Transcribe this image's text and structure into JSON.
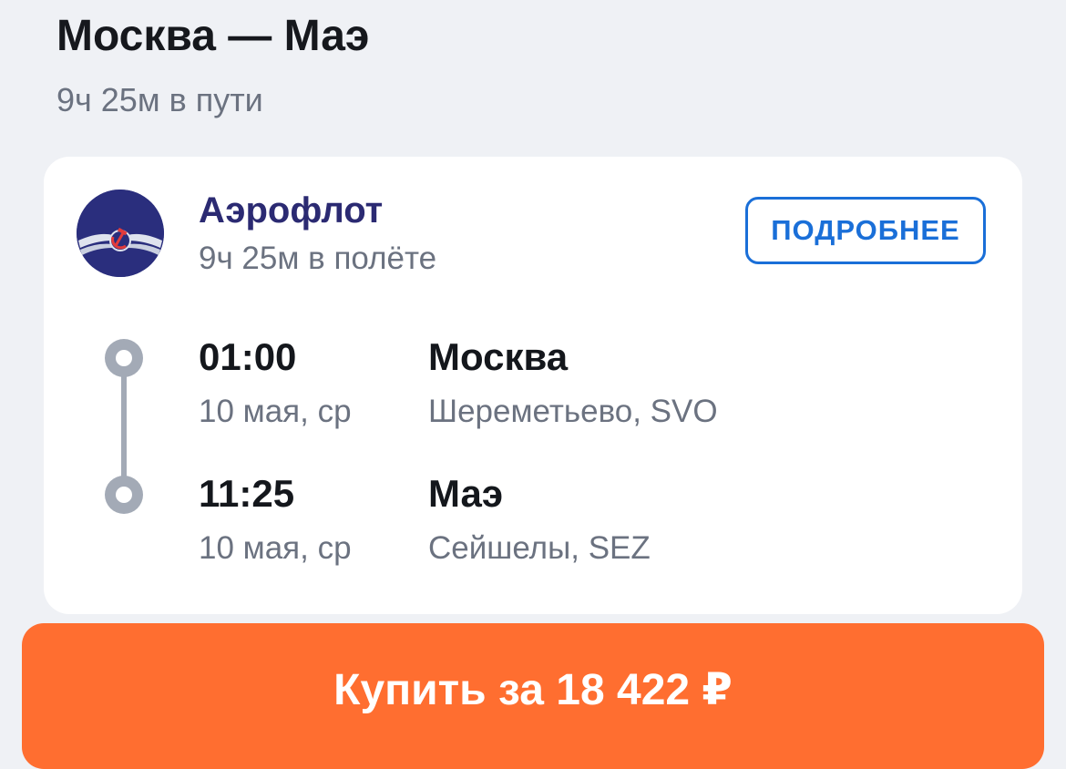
{
  "header": {
    "title": "Москва — Маэ",
    "duration": "9ч 25м в пути"
  },
  "flight": {
    "airline": "Аэрофлот",
    "airline_logo_icon": "aeroflot-winged-hammer-sickle-logo",
    "flight_duration": "9ч 25м в полёте",
    "details_label": "ПОДРОБНЕЕ",
    "departure": {
      "time": "01:00",
      "date": "10 мая, ср",
      "city": "Москва",
      "airport": "Шереметьево, SVO"
    },
    "arrival": {
      "time": "11:25",
      "date": "10 мая, ср",
      "city": "Маэ",
      "airport": "Сейшелы, SEZ"
    }
  },
  "purchase": {
    "label": "Купить за 18 422 ₽"
  },
  "colors": {
    "background": "#eff1f5",
    "card": "#ffffff",
    "airline_name": "#2b2a72",
    "accent_blue": "#1a6fd8",
    "buy_button": "#ff6e30",
    "timeline": "#a3aab6",
    "secondary_text": "#6b7280"
  }
}
